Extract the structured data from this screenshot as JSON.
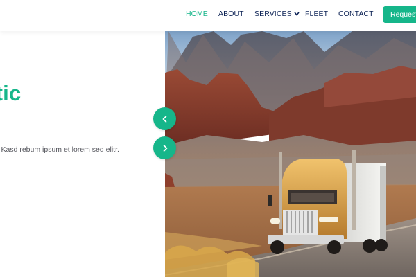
{
  "nav": {
    "items": [
      {
        "label": "HOME",
        "active": true
      },
      {
        "label": "ABOUT",
        "active": false
      },
      {
        "label": "SERVICES",
        "active": false,
        "has_dropdown": true
      },
      {
        "label": "FLEET",
        "active": false
      },
      {
        "label": "CONTACT",
        "active": false
      }
    ],
    "cta_label": "Request"
  },
  "hero": {
    "title": "Logistic",
    "body": "Elitr sadipscing at sed stet sit diam no. Kasd rebum ipsum et lorem sed elitr.",
    "prev_icon": "chevron-left-icon",
    "next_icon": "chevron-right-icon",
    "image_subject": "truck-on-desert-road-image"
  },
  "colors": {
    "accent": "#16b68a",
    "nav_text": "#0b2154",
    "body_text": "#55565d"
  }
}
